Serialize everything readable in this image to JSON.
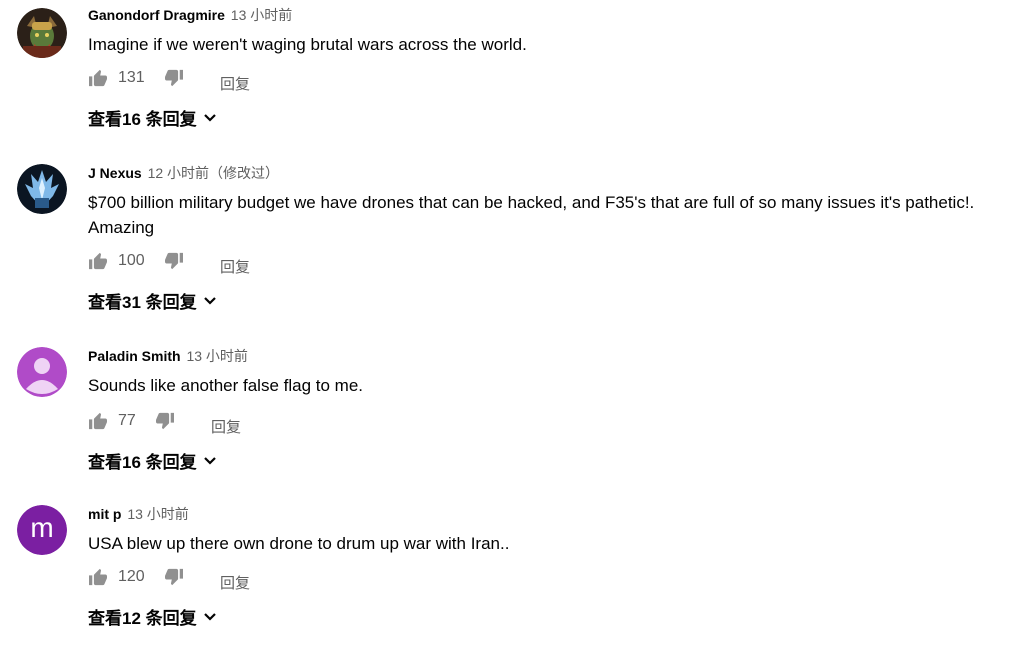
{
  "comments": [
    {
      "author": "Ganondorf Dragmire",
      "time": "13 小时前",
      "text": "Imagine if we weren't waging brutal wars across the world.",
      "likes": "131",
      "reply_label": "回复",
      "replies_label": "查看16 条回复",
      "avatar": {
        "kind": "image",
        "desc": "ganondorf-avatar",
        "bg": "#3a2a1f"
      }
    },
    {
      "author": "J Nexus",
      "time": "12 小时前（修改过）",
      "text": "$700 billion military budget we have drones that can be hacked, and F35's that are full of so many issues it's pathetic!. Amazing",
      "likes": "100",
      "reply_label": "回复",
      "replies_label": "查看31 条回复",
      "avatar": {
        "kind": "image",
        "desc": "ice-crown-avatar",
        "bg": "#0b1522"
      }
    },
    {
      "author": "Paladin Smith",
      "time": "13 小时前",
      "text": "Sounds like another false flag to me.",
      "likes": "77",
      "reply_label": "回复",
      "replies_label": "查看16 条回复",
      "avatar": {
        "kind": "default",
        "desc": "default-user-avatar",
        "bg": "#b04bc8"
      }
    },
    {
      "author": "mit p",
      "time": "13 小时前",
      "text": "USA blew up there own drone to drum up war with Iran..",
      "likes": "120",
      "reply_label": "回复",
      "replies_label": "查看12 条回复",
      "avatar": {
        "kind": "letter",
        "letter": "m",
        "desc": "letter-avatar",
        "bg": "#7b1fa2"
      }
    }
  ],
  "icons": {
    "like": "thumb-up-icon",
    "dislike": "thumb-down-icon",
    "expand": "chevron-down-icon"
  },
  "colors": {
    "text": "#030303",
    "meta": "#606060",
    "icon": "#909090"
  }
}
